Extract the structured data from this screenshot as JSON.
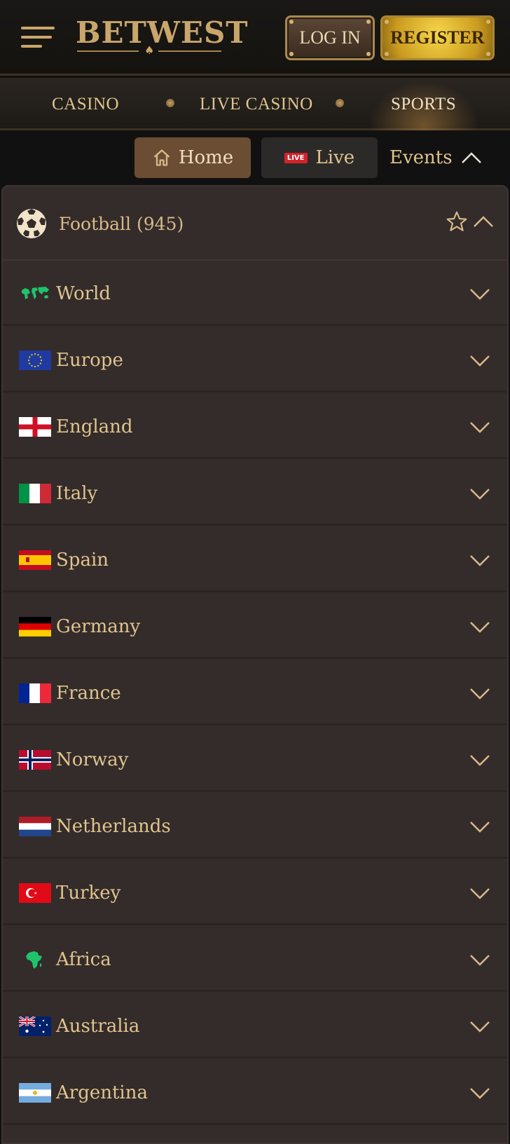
{
  "header": {
    "logo_text": "BETWEST",
    "login_label": "LOG IN",
    "register_label": "REGISTER"
  },
  "nav": {
    "items": [
      "CASINO",
      "LIVE CASINO",
      "SPORTS"
    ],
    "active": "SPORTS"
  },
  "tabs": {
    "home": "Home",
    "live": "Live",
    "live_badge": "LIVE",
    "events": "Events"
  },
  "sport": {
    "title": "Football (945)",
    "icon": "football-icon"
  },
  "regions": [
    {
      "label": "World",
      "flag": "world-map-icon"
    },
    {
      "label": "Europe",
      "flag": "eu-flag"
    },
    {
      "label": "England",
      "flag": "england-flag"
    },
    {
      "label": "Italy",
      "flag": "italy-flag"
    },
    {
      "label": "Spain",
      "flag": "spain-flag"
    },
    {
      "label": "Germany",
      "flag": "germany-flag"
    },
    {
      "label": "France",
      "flag": "france-flag"
    },
    {
      "label": "Norway",
      "flag": "norway-flag"
    },
    {
      "label": "Netherlands",
      "flag": "netherlands-flag"
    },
    {
      "label": "Turkey",
      "flag": "turkey-flag"
    },
    {
      "label": "Africa",
      "flag": "africa-map-icon"
    },
    {
      "label": "Australia",
      "flag": "australia-flag"
    },
    {
      "label": "Argentina",
      "flag": "argentina-flag"
    }
  ],
  "colors": {
    "accent_gold": "#d8b98a",
    "home_tab": "#6b4d33",
    "panel": "#342c2a"
  }
}
